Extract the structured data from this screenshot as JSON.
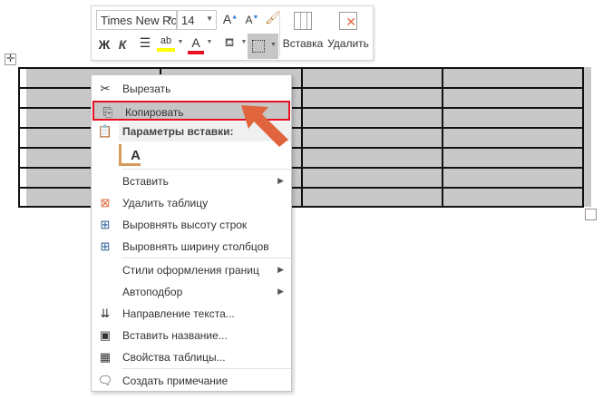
{
  "toolbar": {
    "font_name": "Times New Ro",
    "font_size": "14",
    "grow_font": "A",
    "shrink_font": "A",
    "bold": "Ж",
    "italic": "К",
    "highlight": "ab",
    "font_color": "A",
    "insert_label": "Вставка",
    "delete_label": "Удалить",
    "highlight_color": "#ffff00",
    "font_color_value": "#e81123"
  },
  "menu": {
    "items": [
      {
        "label": "Вырезать",
        "icon": "scissors-icon"
      },
      {
        "label": "Копировать",
        "icon": "copy-icon",
        "highlighted": true
      },
      {
        "label": "Параметры вставки:",
        "icon": "paste-icon"
      },
      {
        "label": "Вставить",
        "submenu": true
      },
      {
        "label": "Удалить таблицу",
        "icon": "delete-table-icon"
      },
      {
        "label": "Выровнять высоту строк",
        "icon": "distribute-rows-icon"
      },
      {
        "label": "Выровнять ширину столбцов",
        "icon": "distribute-columns-icon"
      },
      {
        "label": "Стили оформления границ",
        "submenu": true
      },
      {
        "label": "Автоподбор",
        "submenu": true
      },
      {
        "label": "Направление текста...",
        "icon": "text-direction-icon"
      },
      {
        "label": "Вставить название...",
        "icon": "insert-caption-icon"
      },
      {
        "label": "Свойства таблицы...",
        "icon": "table-properties-icon"
      },
      {
        "label": "Создать примечание",
        "icon": "new-comment-icon"
      }
    ],
    "paste_option": "A"
  },
  "colors": {
    "selection": "#c8c8c8",
    "highlight_border": "#e81123",
    "arrow": "#e0643c"
  }
}
